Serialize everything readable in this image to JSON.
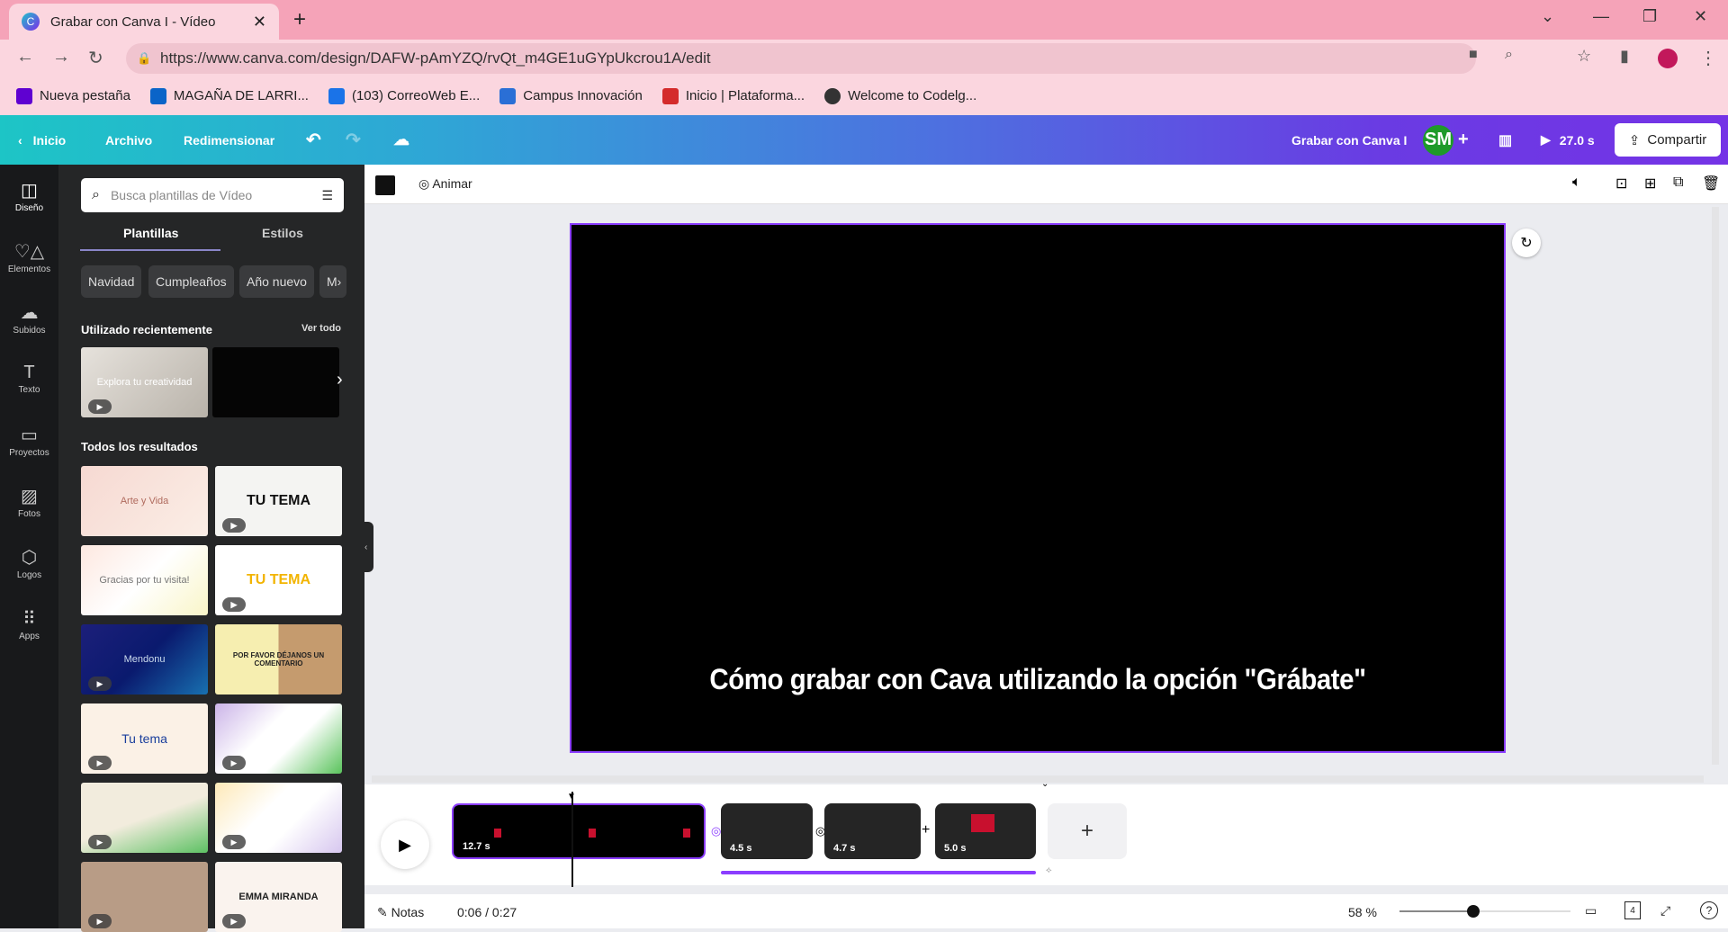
{
  "browser": {
    "tab_title": "Grabar con Canva I - Vídeo",
    "url": "https://www.canva.com/design/DAFW-pAmYZQ/rvQt_m4GE1uGYpUkcrou1A/edit",
    "bookmarks": [
      {
        "label": "Nueva pestaña",
        "color": "#5f01d1"
      },
      {
        "label": "MAGAÑA DE LARRI...",
        "color": "#0a64c8"
      },
      {
        "label": "(103) CorreoWeb E...",
        "color": "#1a73e8"
      },
      {
        "label": "Campus Innovación",
        "color": "#2a6fd6"
      },
      {
        "label": "Inicio | Plataforma...",
        "color": "#d42b2b"
      },
      {
        "label": "Welcome to Codelg...",
        "color": "#333333"
      }
    ]
  },
  "header": {
    "home": "Inicio",
    "file": "Archivo",
    "resize": "Redimensionar",
    "design_title": "Grabar con Canva I",
    "avatar": "SM",
    "duration": "27.0 s",
    "share": "Compartir"
  },
  "rail": [
    {
      "label": "Diseño",
      "icon": "layout-icon"
    },
    {
      "label": "Elementos",
      "icon": "shapes-icon"
    },
    {
      "label": "Subidos",
      "icon": "upload-cloud-icon"
    },
    {
      "label": "Texto",
      "icon": "text-icon"
    },
    {
      "label": "Proyectos",
      "icon": "folder-icon"
    },
    {
      "label": "Fotos",
      "icon": "image-icon"
    },
    {
      "label": "Logos",
      "icon": "logo-icon"
    },
    {
      "label": "Apps",
      "icon": "apps-grid-icon"
    }
  ],
  "panel": {
    "search_placeholder": "Busca plantillas de Vídeo",
    "tabs": [
      "Plantillas",
      "Estilos"
    ],
    "chips": [
      "Navidad",
      "Cumpleaños",
      "Año nuevo",
      "M"
    ],
    "recent_title": "Utilizado recientemente",
    "see_all": "Ver todo",
    "recent": [
      "Explora tu creatividad",
      ""
    ],
    "results_title": "Todos los resultados",
    "results": [
      "Arte y Vida",
      "TU TEMA",
      "Gracias por tu visita!",
      "TU TEMA",
      "Mendonu",
      "POR FAVOR DÉJANOS UN COMENTARIO",
      "Tu tema",
      "",
      "",
      "",
      "",
      "EMMA MIRANDA"
    ]
  },
  "toolbar": {
    "animate": "Animar"
  },
  "canvas": {
    "caption": "Cómo grabar con Cava utilizando la opción \"Grábate\""
  },
  "timeline": {
    "clips": [
      "12.7 s",
      "4.5 s",
      "4.7 s",
      "5.0 s"
    ]
  },
  "footer": {
    "notes": "Notas",
    "time": "0:06 / 0:27",
    "zoom": "58 %",
    "zoom_fraction": 0.43,
    "pages": "4"
  }
}
